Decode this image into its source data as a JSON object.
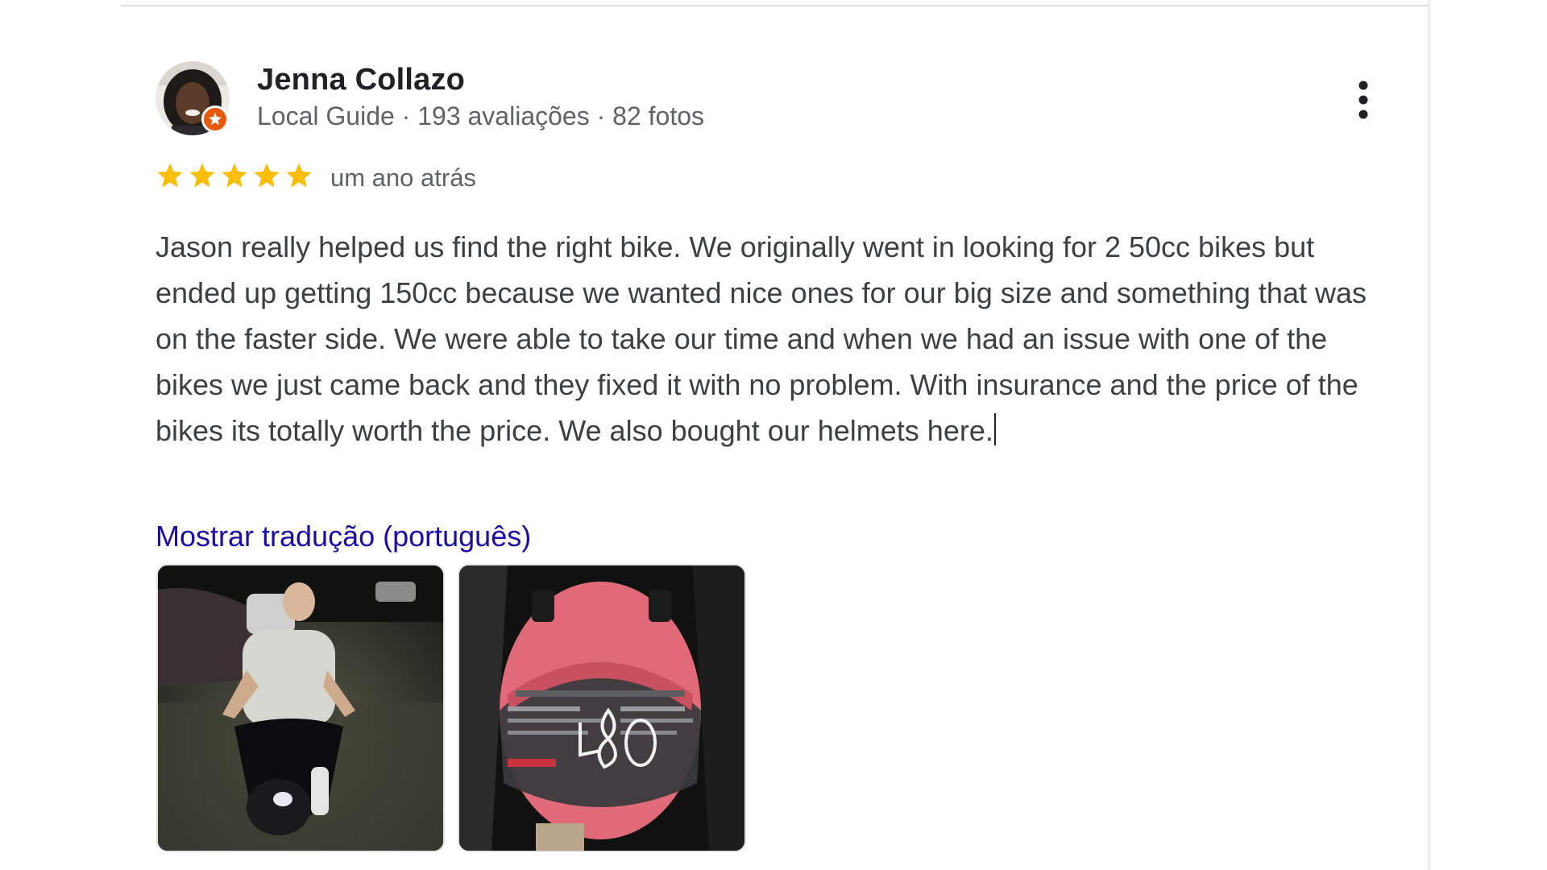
{
  "review": {
    "author": {
      "name": "Jenna Collazo",
      "meta": "Local Guide · 193 avaliações · 82 fotos",
      "badge_icon": "local-guide-star-icon"
    },
    "rating": {
      "stars": 5,
      "max": 5,
      "star_color": "#fbbc04",
      "time": "um ano atrás"
    },
    "text": "Jason really helped us find the right bike. We originally went in looking for 2 50cc bikes but ended up getting 150cc because we wanted nice ones for our big size and something that was on the faster side. We were able to take our time and when we had an issue with one of the bikes we just came back and they fixed it with no problem. With insurance and the price of the bikes its totally worth the price. We also bought our helmets here.",
    "translate_link": "Mostrar tradução (português)",
    "more_icon": "more-vertical-icon",
    "photos": [
      {
        "description_icon": "photo-man-on-scooter"
      },
      {
        "description_icon": "photo-pink-helmet",
        "helmet_brand": "Jockai",
        "helmet_marker": "L 80",
        "helmet_warning": "WARNING"
      }
    ]
  },
  "colors": {
    "link": "#1a0dab",
    "meta_text": "#5f6368",
    "badge": "#e8590c"
  }
}
